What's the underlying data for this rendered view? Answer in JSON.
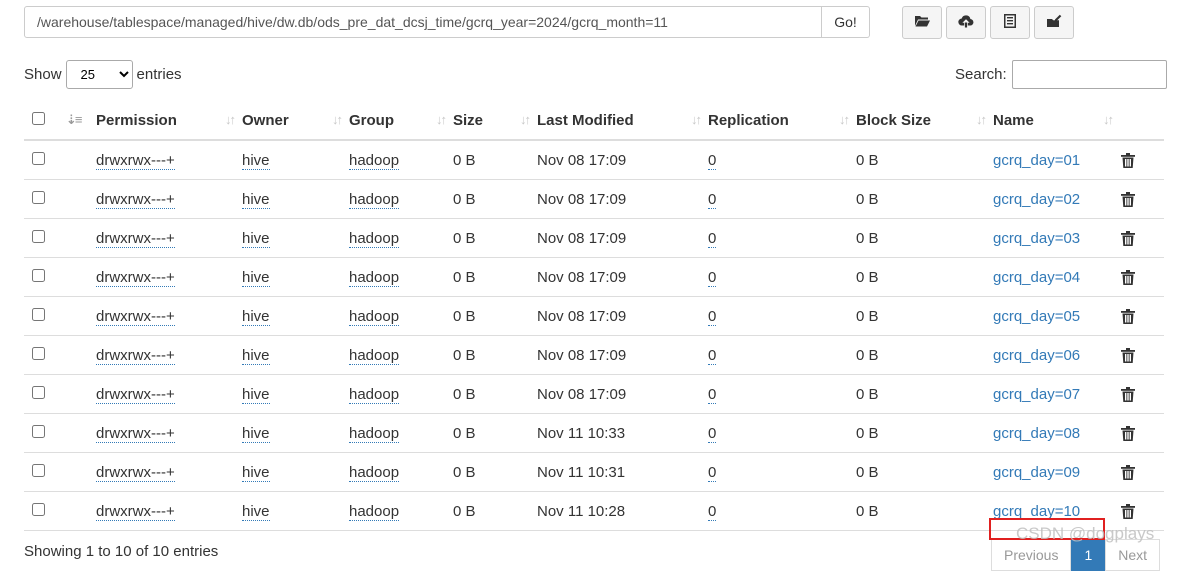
{
  "path": {
    "value": "/warehouse/tablespace/managed/hive/dw.db/ods_pre_dat_dcsj_time/gcrq_year=2024/gcrq_month=11",
    "go_label": "Go!"
  },
  "toolbar": [
    "folder-open-icon",
    "cloud-upload-icon",
    "list-alt-icon",
    "edit-folder-icon"
  ],
  "length": {
    "prefix": "Show",
    "selected": "25",
    "suffix": "entries"
  },
  "search": {
    "label": "Search:",
    "value": ""
  },
  "columns": [
    "Permission",
    "Owner",
    "Group",
    "Size",
    "Last Modified",
    "Replication",
    "Block Size",
    "Name"
  ],
  "rows": [
    {
      "permission": "drwxrwx---+",
      "owner": "hive",
      "group": "hadoop",
      "size": "0 B",
      "modified": "Nov 08 17:09",
      "replication": "0",
      "block_size": "0 B",
      "name": "gcrq_day=01"
    },
    {
      "permission": "drwxrwx---+",
      "owner": "hive",
      "group": "hadoop",
      "size": "0 B",
      "modified": "Nov 08 17:09",
      "replication": "0",
      "block_size": "0 B",
      "name": "gcrq_day=02"
    },
    {
      "permission": "drwxrwx---+",
      "owner": "hive",
      "group": "hadoop",
      "size": "0 B",
      "modified": "Nov 08 17:09",
      "replication": "0",
      "block_size": "0 B",
      "name": "gcrq_day=03"
    },
    {
      "permission": "drwxrwx---+",
      "owner": "hive",
      "group": "hadoop",
      "size": "0 B",
      "modified": "Nov 08 17:09",
      "replication": "0",
      "block_size": "0 B",
      "name": "gcrq_day=04"
    },
    {
      "permission": "drwxrwx---+",
      "owner": "hive",
      "group": "hadoop",
      "size": "0 B",
      "modified": "Nov 08 17:09",
      "replication": "0",
      "block_size": "0 B",
      "name": "gcrq_day=05"
    },
    {
      "permission": "drwxrwx---+",
      "owner": "hive",
      "group": "hadoop",
      "size": "0 B",
      "modified": "Nov 08 17:09",
      "replication": "0",
      "block_size": "0 B",
      "name": "gcrq_day=06"
    },
    {
      "permission": "drwxrwx---+",
      "owner": "hive",
      "group": "hadoop",
      "size": "0 B",
      "modified": "Nov 08 17:09",
      "replication": "0",
      "block_size": "0 B",
      "name": "gcrq_day=07"
    },
    {
      "permission": "drwxrwx---+",
      "owner": "hive",
      "group": "hadoop",
      "size": "0 B",
      "modified": "Nov 11 10:33",
      "replication": "0",
      "block_size": "0 B",
      "name": "gcrq_day=08"
    },
    {
      "permission": "drwxrwx---+",
      "owner": "hive",
      "group": "hadoop",
      "size": "0 B",
      "modified": "Nov 11 10:31",
      "replication": "0",
      "block_size": "0 B",
      "name": "gcrq_day=09"
    },
    {
      "permission": "drwxrwx---+",
      "owner": "hive",
      "group": "hadoop",
      "size": "0 B",
      "modified": "Nov 11 10:28",
      "replication": "0",
      "block_size": "0 B",
      "name": "gcrq_day=10"
    }
  ],
  "footer": {
    "info": "Showing 1 to 10 of 10 entries",
    "previous": "Previous",
    "page": "1",
    "next": "Next"
  },
  "watermark": "CSDN @dogplays",
  "colors": {
    "link": "#337ab7",
    "highlight_box": "#e02020"
  }
}
